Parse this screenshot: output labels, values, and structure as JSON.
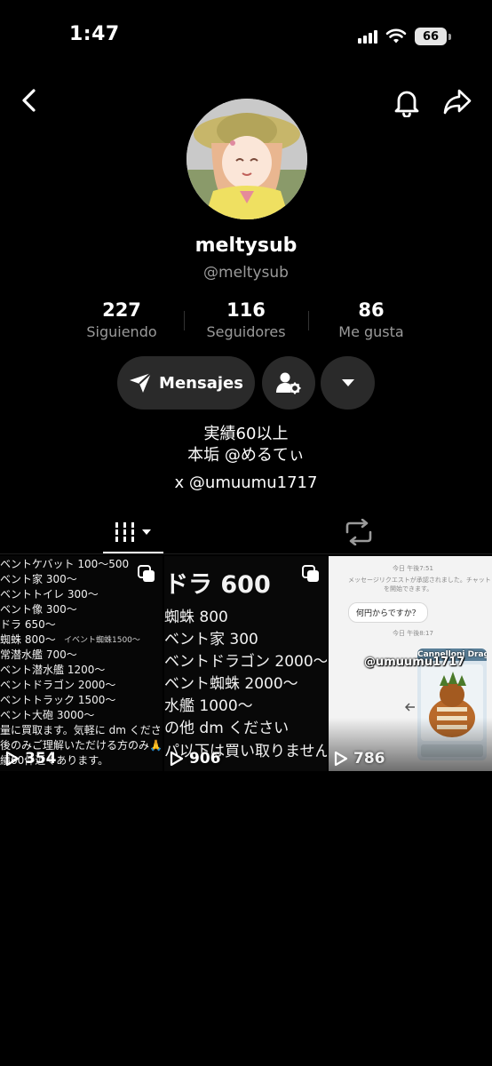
{
  "status_bar": {
    "time": "1:47",
    "battery": "66"
  },
  "profile": {
    "display_name": "meltysub",
    "username": "@meltysub"
  },
  "stats": [
    {
      "value": "227",
      "label": "Siguiendo"
    },
    {
      "value": "116",
      "label": "Seguidores"
    },
    {
      "value": "86",
      "label": "Me gusta"
    }
  ],
  "actions": {
    "message_label": "Mensajes"
  },
  "bio": {
    "line1": "実績60以上",
    "line2": "本垢 @めるてぃ",
    "line3": "x @umuumu1717"
  },
  "videos": [
    {
      "views": "354",
      "lines": [
        "ベントケバット 100～500",
        "ベント家 300～",
        "ベントトイレ 300～",
        "ベント像 300～",
        "ドラ 650～",
        "蜘蛛 800～",
        "常潜水艦 700～",
        "ベント潜水艦 1200～",
        "ベントドラゴン 2000～",
        "ベントトラック 1500～",
        "ベント大砲 3000～",
        "量に買取ます。気軽に dm ください",
        "後のみご理解いただける方のみ🙏",
        "績60件近くあります。"
      ],
      "side_note": "イベント蜘蛛1500～"
    },
    {
      "views": "906",
      "lines": [
        "ドラ 600",
        "蜘蛛 800",
        "ベント家 300",
        "ベントドラゴン 2000～",
        "ベント蜘蛛 2000～",
        "水艦 1000～",
        "の他 dm ください",
        "パ以下は買い取りません。"
      ]
    },
    {
      "views": "786",
      "chat_date1": "今日 午後7:51",
      "chat_notice1": "メッセージリクエストが承認されました。チャット",
      "chat_notice2": "を開始できます。",
      "bubble": "何円からですか？",
      "chat_date2": "今日 午後8:17",
      "overlay": "@umuumu1717",
      "card_title": "Cannelloni Dragoni"
    }
  ]
}
